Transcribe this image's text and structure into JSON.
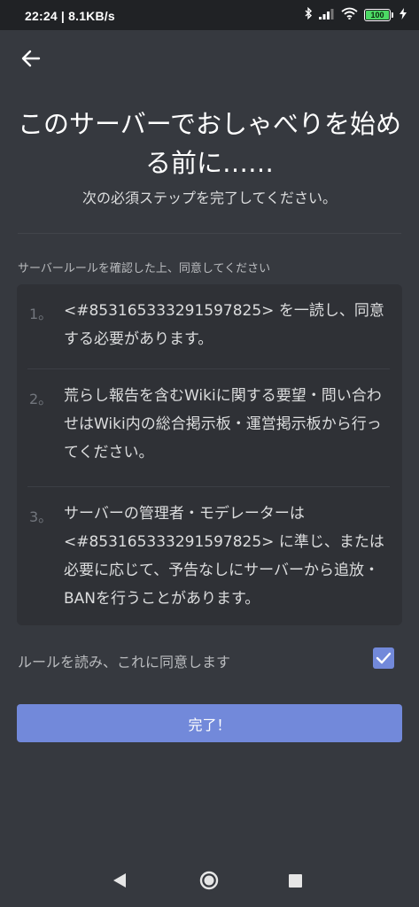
{
  "status_bar": {
    "time": "22:24",
    "net_speed": "8.1KB/s",
    "battery": "100",
    "icons": [
      "bluetooth-icon",
      "signal-icon",
      "wifi-icon",
      "battery-icon",
      "charging-icon"
    ]
  },
  "header": {
    "back_icon": "back-arrow-icon",
    "title": "このサーバーでおしゃべりを始める前に……",
    "subtitle": "次の必須ステップを完了してください。"
  },
  "rules_section": {
    "label": "サーバールールを確認した上、同意してください",
    "rules": [
      {
        "num": "1。",
        "text": "<#853165333291597825> を一読し、同意する必要があります。"
      },
      {
        "num": "2。",
        "text": "荒らし報告を含むWikiに関する要望・問い合わせはWiki内の総合掲示板・運営掲示板から行ってください。"
      },
      {
        "num": "3。",
        "text": "サーバーの管理者・モデレーターは<#853165333291597825> に準じ、または必要に応じて、予告なしにサーバーから追放・BANを行うことがあります。"
      }
    ]
  },
  "agreement": {
    "label": "ルールを読み、これに同意します",
    "checked": true
  },
  "done_button": {
    "label": "完了！"
  },
  "colors": {
    "background": "#36393f",
    "rules_box": "#2f3136",
    "accent": "#7289da",
    "status_bar": "#202225"
  }
}
